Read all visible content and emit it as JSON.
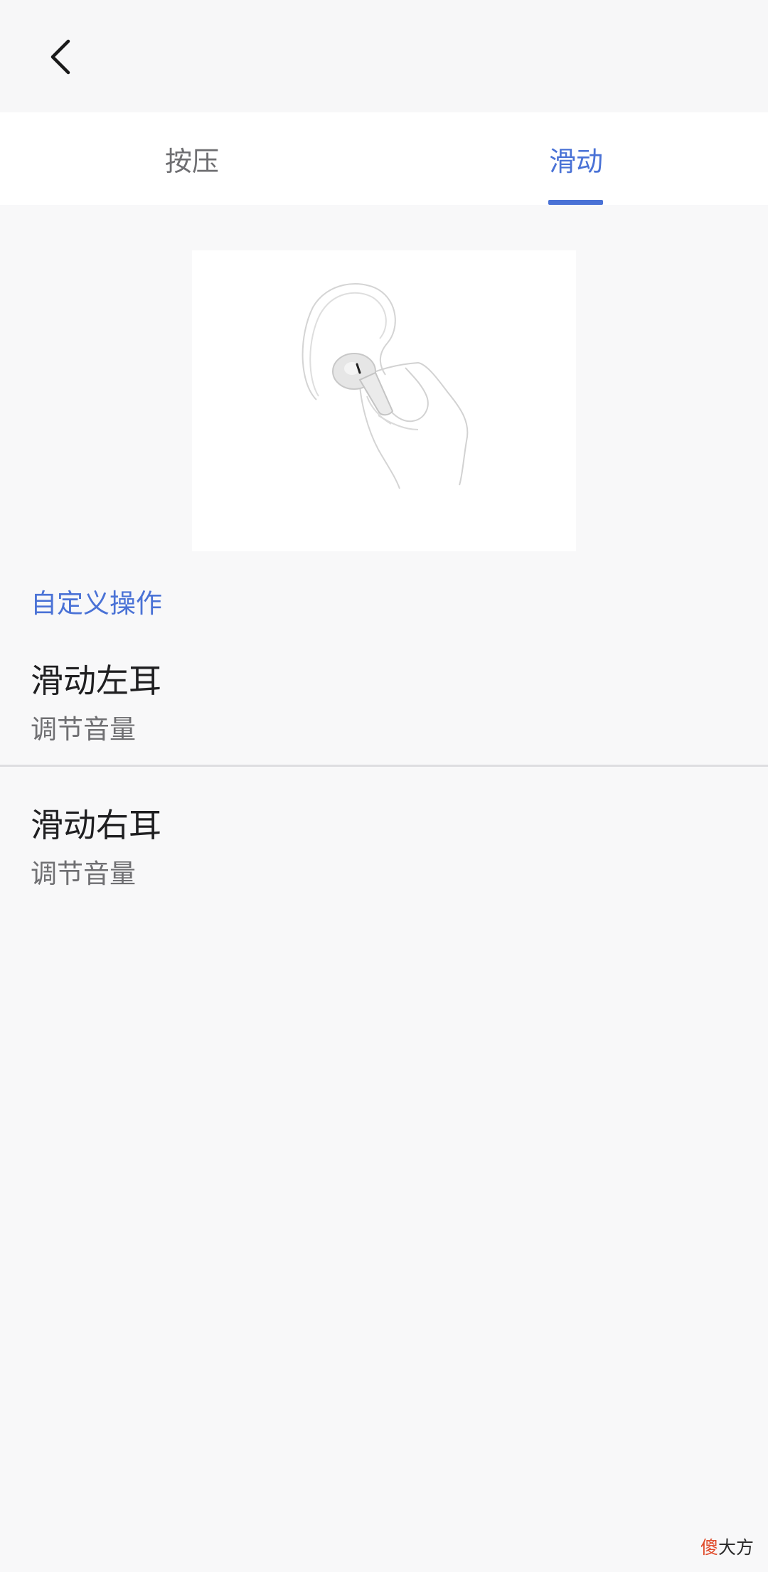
{
  "header": {
    "back_icon": "chevron-left-icon"
  },
  "tabs": [
    {
      "label": "按压",
      "selected": false
    },
    {
      "label": "滑动",
      "selected": true
    }
  ],
  "colors": {
    "accent": "#4a72d6",
    "background": "#f8f8f9",
    "tab_bar": "#ffffff",
    "primary_text": "#1f1f21",
    "secondary_text": "#6f6f72"
  },
  "illustration": {
    "icon": "earbud-in-ear-swipe-illustration"
  },
  "section": {
    "title": "自定义操作"
  },
  "items": [
    {
      "title": "滑动左耳",
      "subtitle": "调节音量"
    },
    {
      "title": "滑动右耳",
      "subtitle": "调节音量"
    }
  ],
  "watermark": {
    "accent_text": "傻",
    "text": "大方"
  }
}
